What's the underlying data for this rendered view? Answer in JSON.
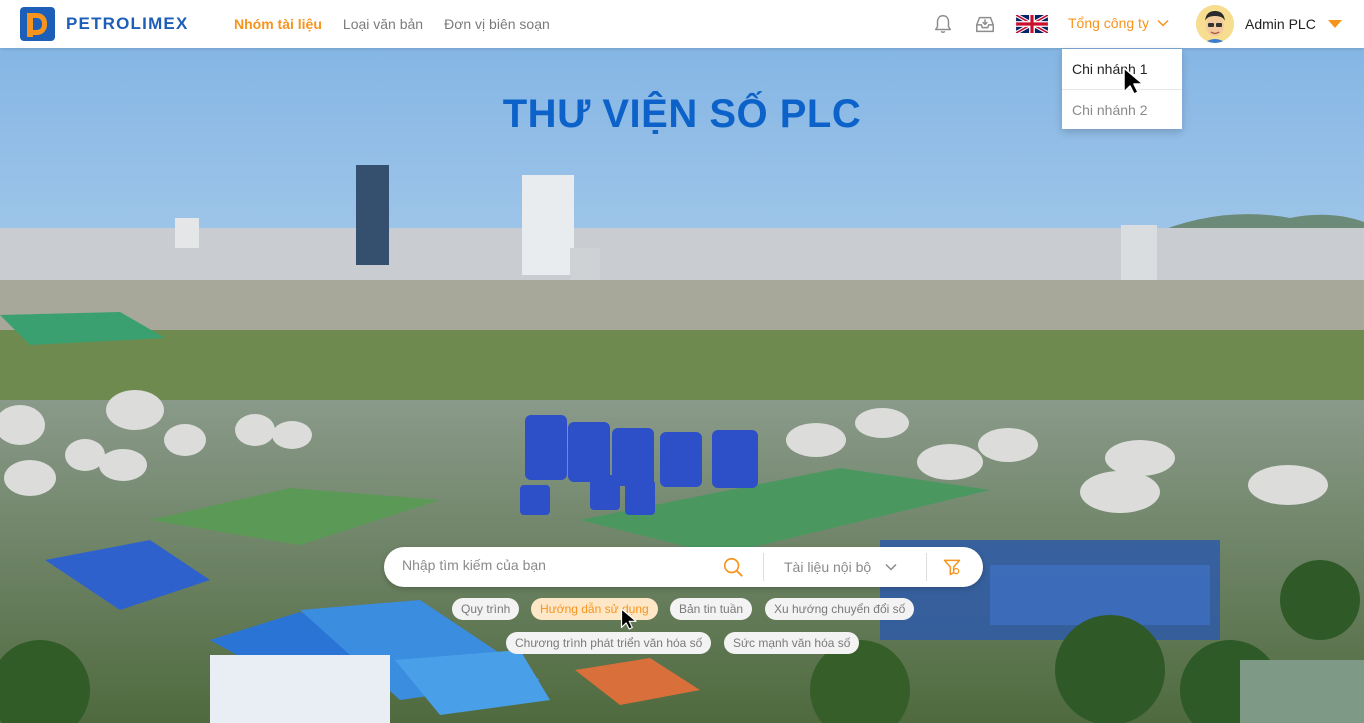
{
  "brand": {
    "name": "PETROLIMEX",
    "primary_color": "#1d5fb8",
    "accent_color": "#f7941d"
  },
  "nav": {
    "items": [
      {
        "label": "Nhóm tài liệu",
        "active": true
      },
      {
        "label": "Loại văn bản",
        "active": false
      },
      {
        "label": "Đơn vị biên soạn",
        "active": false
      }
    ]
  },
  "header": {
    "notification_icon": "bell-icon",
    "inbox_icon": "inbox-download-icon",
    "language_icon": "uk-flag-icon",
    "company_selector": "Tổng công ty",
    "user_name": "Admin PLC"
  },
  "company_dropdown": {
    "items": [
      "Chi nhánh 1",
      "Chi nhánh 2"
    ]
  },
  "hero": {
    "title": "THƯ VIỆN SỐ PLC"
  },
  "search": {
    "placeholder": "Nhập tìm kiếm của bạn",
    "doc_type_selected": "Tài liệu nội bộ",
    "search_icon": "search-icon",
    "filter_icon": "filter-icon"
  },
  "tags": [
    {
      "label": "Quy trình",
      "active": false
    },
    {
      "label": "Hướng dẫn sử dụng",
      "active": true
    },
    {
      "label": "Bản tin tuần",
      "active": false
    },
    {
      "label": "Xu hướng chuyển đổi số",
      "active": false
    },
    {
      "label": "Chương trình phát triển văn hóa số",
      "active": false
    },
    {
      "label": "Sức mạnh văn hóa số",
      "active": false
    }
  ]
}
